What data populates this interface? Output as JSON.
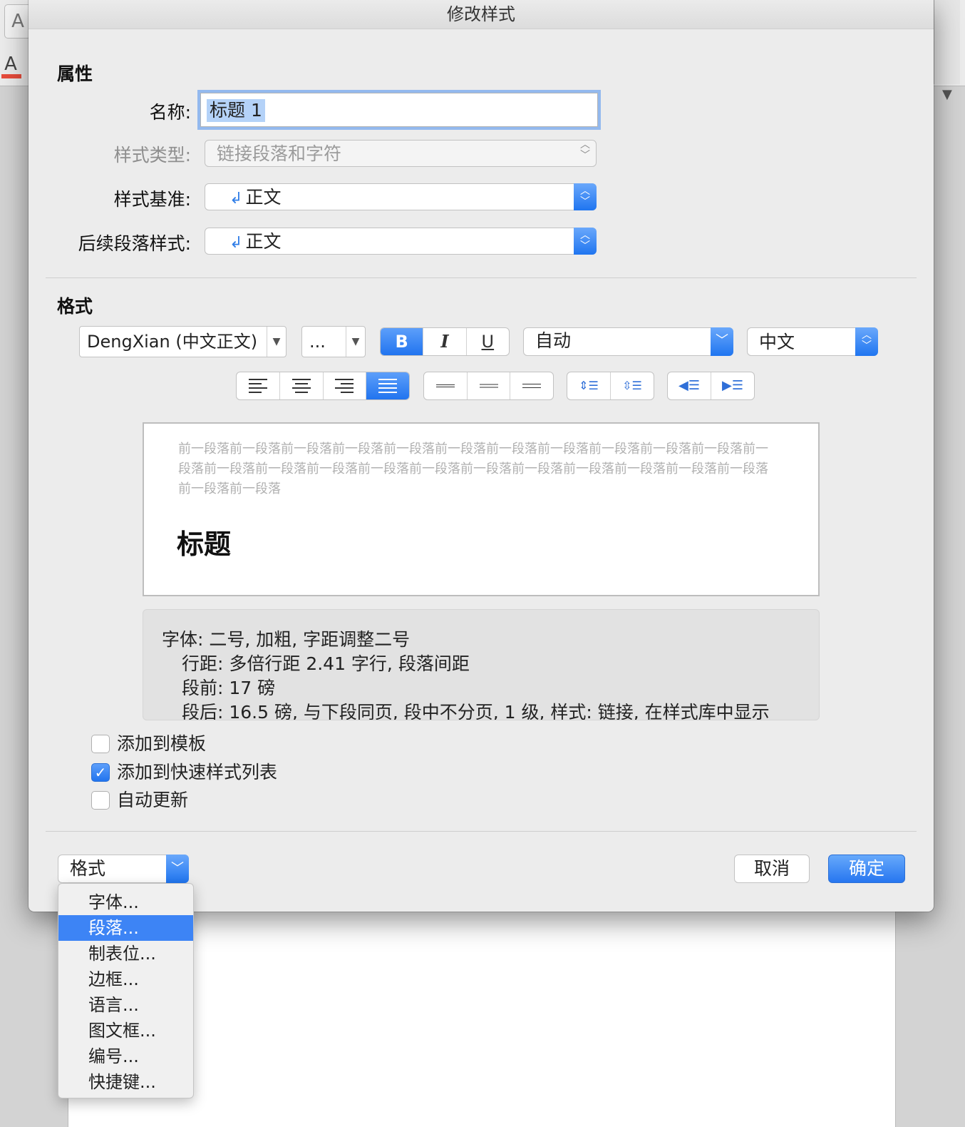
{
  "background": {
    "toolbar_button_glyph": "A",
    "font_color_glyph": "A",
    "scroll_arrow": "▼"
  },
  "dialog": {
    "title": "修改样式",
    "properties": {
      "section_title": "属性",
      "name_label": "名称:",
      "name_value": "标题 1",
      "style_type_label": "样式类型:",
      "style_type_value": "链接段落和字符",
      "based_on_label": "样式基准:",
      "based_on_value": "正文",
      "next_style_label": "后续段落样式:",
      "next_style_value": "正文"
    },
    "format": {
      "section_title": "格式",
      "font_name": "DengXian (中文正文)",
      "font_size": "...",
      "bold": "B",
      "italic": "I",
      "underline": "U",
      "color": "自动",
      "language": "中文",
      "bold_active": true
    },
    "preview": {
      "previous_paragraph": "前一段落前一段落前一段落前一段落前一段落前一段落前一段落前一段落前一段落前一段落前一段落前一段落前一段落前一段落前一段落前一段落前一段落前一段落前一段落前一段落前一段落前一段落前一段落前一段落前一段落",
      "heading": "标题"
    },
    "description": {
      "line1": "字体: 二号, 加粗, 字距调整二号",
      "line2": "行距: 多倍行距 2.41 字行, 段落间距",
      "line3": "段前: 17 磅",
      "line4": "段后: 16.5 磅, 与下段同页, 段中不分页, 1 级, 样式: 链接, 在样式库中显示"
    },
    "options": {
      "add_to_template": "添加到模板",
      "add_to_template_checked": false,
      "add_to_quick_styles": "添加到快速样式列表",
      "add_to_quick_styles_checked": true,
      "auto_update": "自动更新",
      "auto_update_checked": false
    },
    "format_button": "格式",
    "cancel_button": "取消",
    "ok_button": "确定"
  },
  "format_menu": {
    "items": [
      "字体...",
      "段落...",
      "制表位...",
      "边框...",
      "语言...",
      "图文框...",
      "编号...",
      "快捷键..."
    ],
    "highlighted": "段落..."
  },
  "colors": {
    "accent": "#2174ef",
    "highlight": "#3d84f5",
    "dialog_bg": "#ececec"
  }
}
